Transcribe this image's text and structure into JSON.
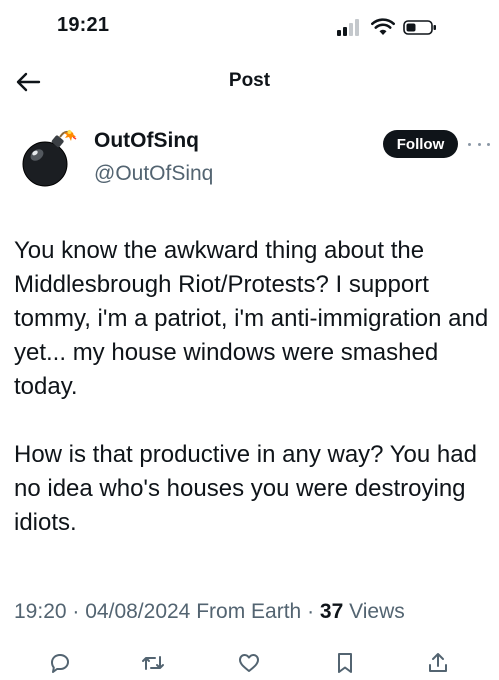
{
  "status_bar": {
    "time": "19:21",
    "icons": [
      "signal-icon",
      "wifi-icon",
      "battery-icon"
    ]
  },
  "nav": {
    "title": "Post",
    "back_icon": "arrow-left-icon"
  },
  "author": {
    "display_name": "OutOfSinq",
    "handle": "@OutOfSinq",
    "avatar_icon": "bomb-icon",
    "follow_label": "Follow",
    "more_icon": "more-horizontal-icon"
  },
  "tweet": {
    "paragraphs": [
      "You know the awkward thing about the Middlesbrough Riot/Protests? I support tommy, i'm a patriot, i'm anti-immigration and yet... my house windows were smashed today.",
      "How is that productive in any way? You had no idea who's houses you were destroying idiots."
    ]
  },
  "meta": {
    "time": "19:20",
    "separator": "·",
    "date": "04/08/2024",
    "source": "From Earth",
    "views_count": "37",
    "views_label": "Views"
  },
  "actions": [
    {
      "name": "reply",
      "icon": "reply-icon"
    },
    {
      "name": "repost",
      "icon": "repost-icon"
    },
    {
      "name": "like",
      "icon": "heart-icon"
    },
    {
      "name": "bookmark",
      "icon": "bookmark-icon"
    },
    {
      "name": "share",
      "icon": "share-icon"
    }
  ],
  "colors": {
    "text": "#0f1419",
    "secondary": "#536471",
    "follow_bg": "#0f1419",
    "background": "#ffffff"
  }
}
